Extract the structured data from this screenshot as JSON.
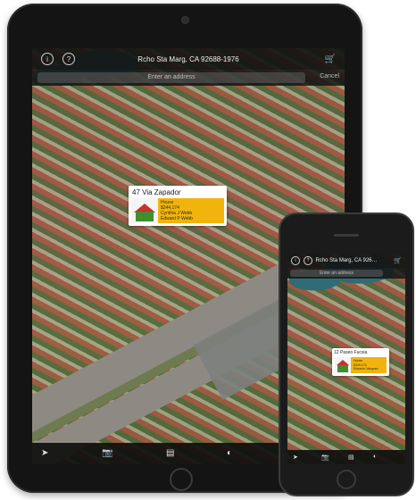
{
  "ipad": {
    "title": "Rcho Sta Marg, CA 92688-1976",
    "search_placeholder": "Enter an address",
    "cancel_label": "Cancel",
    "callout": {
      "address": "47 Via Zapador",
      "type": "House",
      "price": "$244,174",
      "agent_1": "Cynthia J Webb",
      "agent_2": "Edward P Webb"
    }
  },
  "iphone": {
    "title": "Rcho Sta Marg, CA 926…",
    "search_placeholder": "Enter an address",
    "callout": {
      "address": "12 Paseo Fucsia",
      "type": "House",
      "price": "$249,174",
      "agent": "Eduardo Vasquez"
    }
  },
  "icons": {
    "info": "info-icon",
    "help": "help-icon",
    "cart": "cart-icon",
    "locate": "location-arrow-icon",
    "camera": "camera-icon",
    "listing": "listing-icon",
    "share": "share-icon"
  },
  "colors": {
    "accent": "#f2b21a",
    "callout_yellow": "#f1b40c",
    "roof_red": "#c8322a"
  }
}
